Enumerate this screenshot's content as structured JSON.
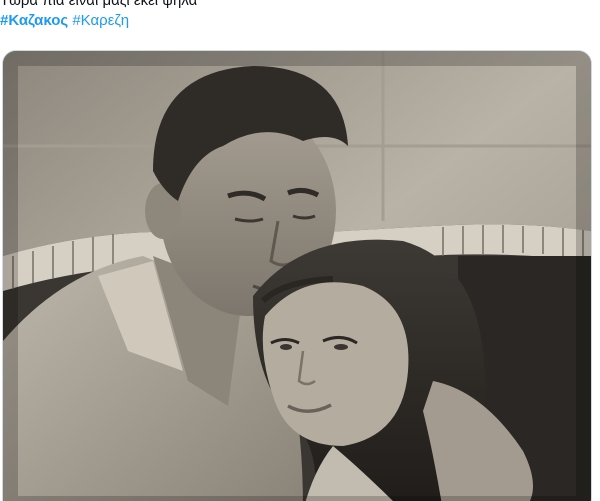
{
  "tweet": {
    "text_line": "Τώρα πια είναι μαζί εκεί ψηλά",
    "hashtags": [
      "#Καζακος",
      "#Καρεζη"
    ]
  },
  "media": {
    "kind": "black-and-white-photo",
    "description_icon": "photo-icon"
  },
  "colors": {
    "text": "#0f1419",
    "hashtag": "#1d9bf0",
    "border": "#cfd9de"
  }
}
